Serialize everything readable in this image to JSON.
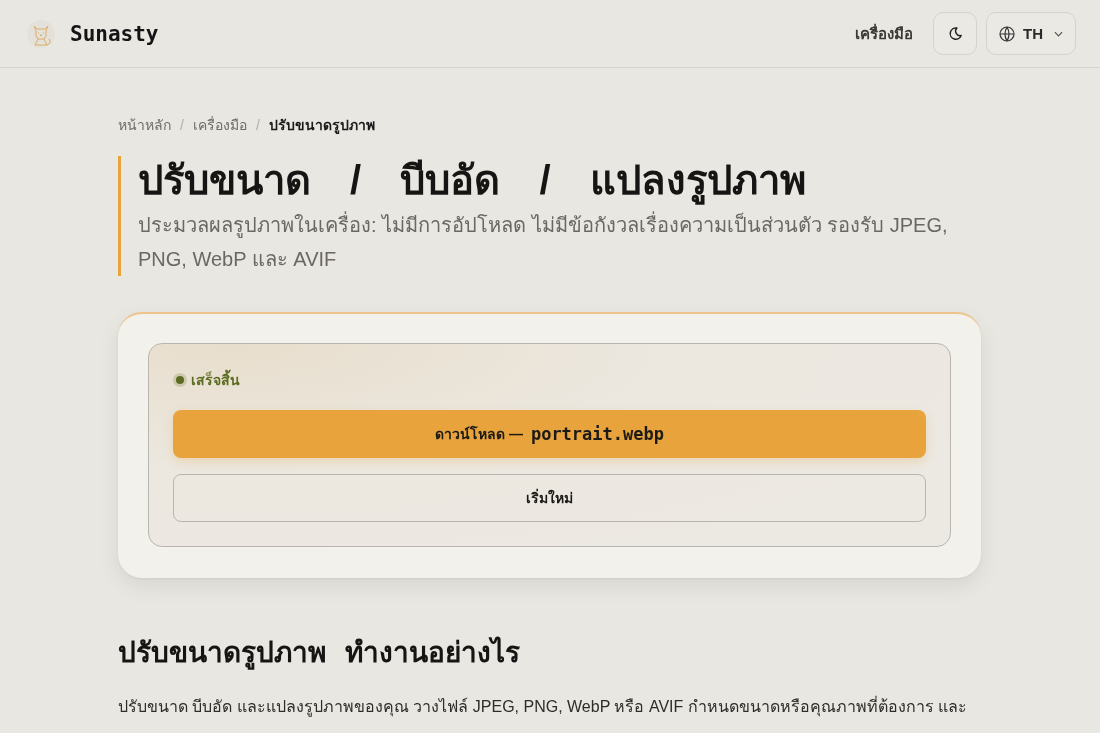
{
  "header": {
    "brand": "Sunasty",
    "nav_link": "เครื่องมือ",
    "language": "TH"
  },
  "breadcrumb": [
    {
      "label": "หน้าหลัก",
      "current": false,
      "separator": "/"
    },
    {
      "label": "เครื่องมือ",
      "current": false,
      "separator": "/"
    },
    {
      "label": "ปรับขนาดรูปภาพ",
      "current": true
    }
  ],
  "page": {
    "title": "ปรับขนาด / บีบอัด / แปลงรูปภาพ",
    "subtitle": "ประมวลผลรูปภาพในเครื่อง: ไม่มีการอัปโหลด ไม่มีข้อกังวลเรื่องความเป็นส่วนตัว รองรับ JPEG, PNG, WebP และ AVIF"
  },
  "result": {
    "status": {
      "label": "เสร็จสิ้น",
      "complete": true
    },
    "download_button": {
      "label": "ดาวน์โหลด —",
      "filename": "portrait.webp"
    },
    "restart_button": "เริ่มใหม่"
  },
  "section": {
    "heading": "ปรับขนาดรูปภาพ ทำงานอย่างไร",
    "paragraph": "ปรับขนาด บีบอัด และแปลงรูปภาพของคุณ วางไฟล์ JPEG, PNG, WebP หรือ AVIF กำหนดขนาดหรือคุณภาพที่ต้องการ และ"
  }
}
